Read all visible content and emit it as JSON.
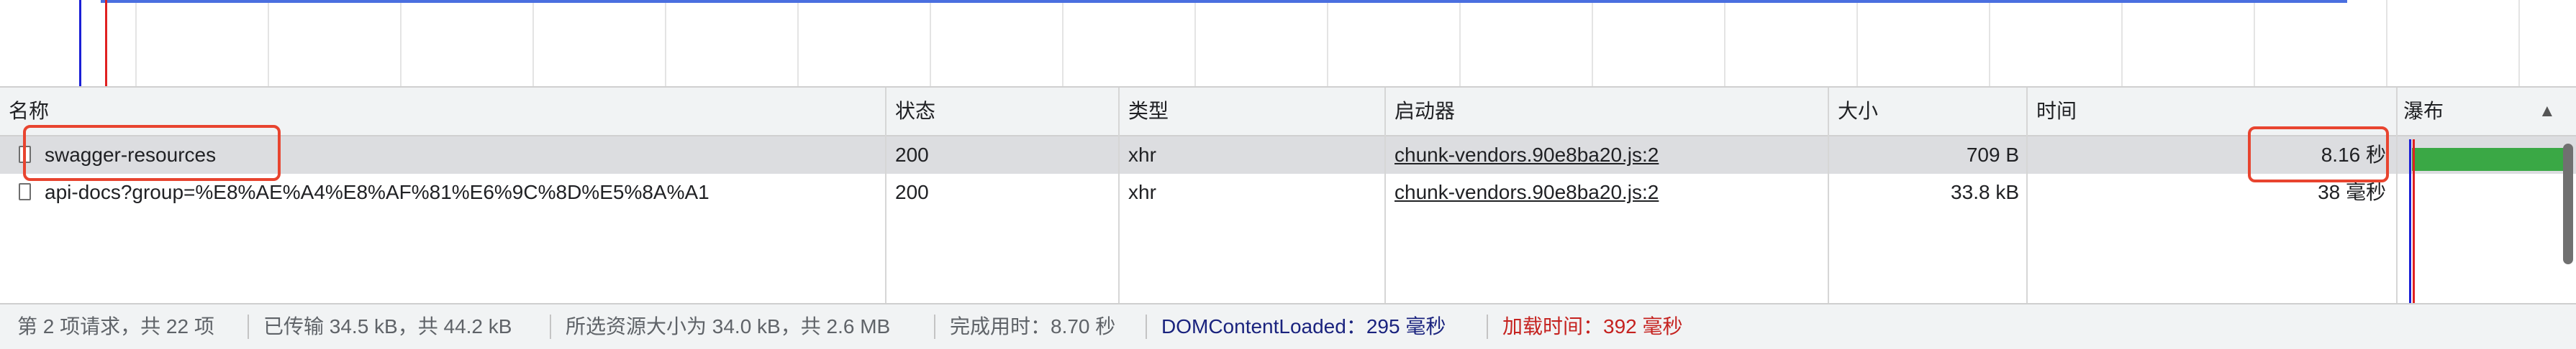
{
  "overview": {
    "grid_count": 18
  },
  "table": {
    "columns": [
      {
        "key": "name",
        "label": "名称"
      },
      {
        "key": "status",
        "label": "状态"
      },
      {
        "key": "type",
        "label": "类型"
      },
      {
        "key": "initiator",
        "label": "启动器"
      },
      {
        "key": "size",
        "label": "大小"
      },
      {
        "key": "time",
        "label": "时间"
      },
      {
        "key": "waterfall",
        "label": "瀑布"
      }
    ],
    "sort_indicator": "▲",
    "rows": [
      {
        "name": "swagger-resources",
        "status": "200",
        "type": "xhr",
        "initiator": "chunk-vendors.90e8ba20.js:2",
        "size": "709 B",
        "time": "8.16 秒",
        "selected": true
      },
      {
        "name": "api-docs?group=%E8%AE%A4%E8%AF%81%E6%9C%8D%E5%8A%A1",
        "status": "200",
        "type": "xhr",
        "initiator": "chunk-vendors.90e8ba20.js:2",
        "size": "33.8 kB",
        "time": "38 毫秒",
        "selected": false
      }
    ]
  },
  "status_bar": {
    "requests": "第 2 项请求，共 22 项",
    "transferred": "已传输 34.5 kB，共 44.2 kB",
    "resources": "所选资源大小为 34.0 kB，共 2.6 MB",
    "finish": "完成用时：8.70 秒",
    "dcl": "DOMContentLoaded：295 毫秒",
    "load": "加载时间：392 毫秒"
  },
  "colors": {
    "dcl_line": "#1a1fd6",
    "load_line": "#e02020",
    "waterfall_bar": "#3aa845",
    "highlight": "#e8442f",
    "selected_row": "#dcdde0"
  }
}
